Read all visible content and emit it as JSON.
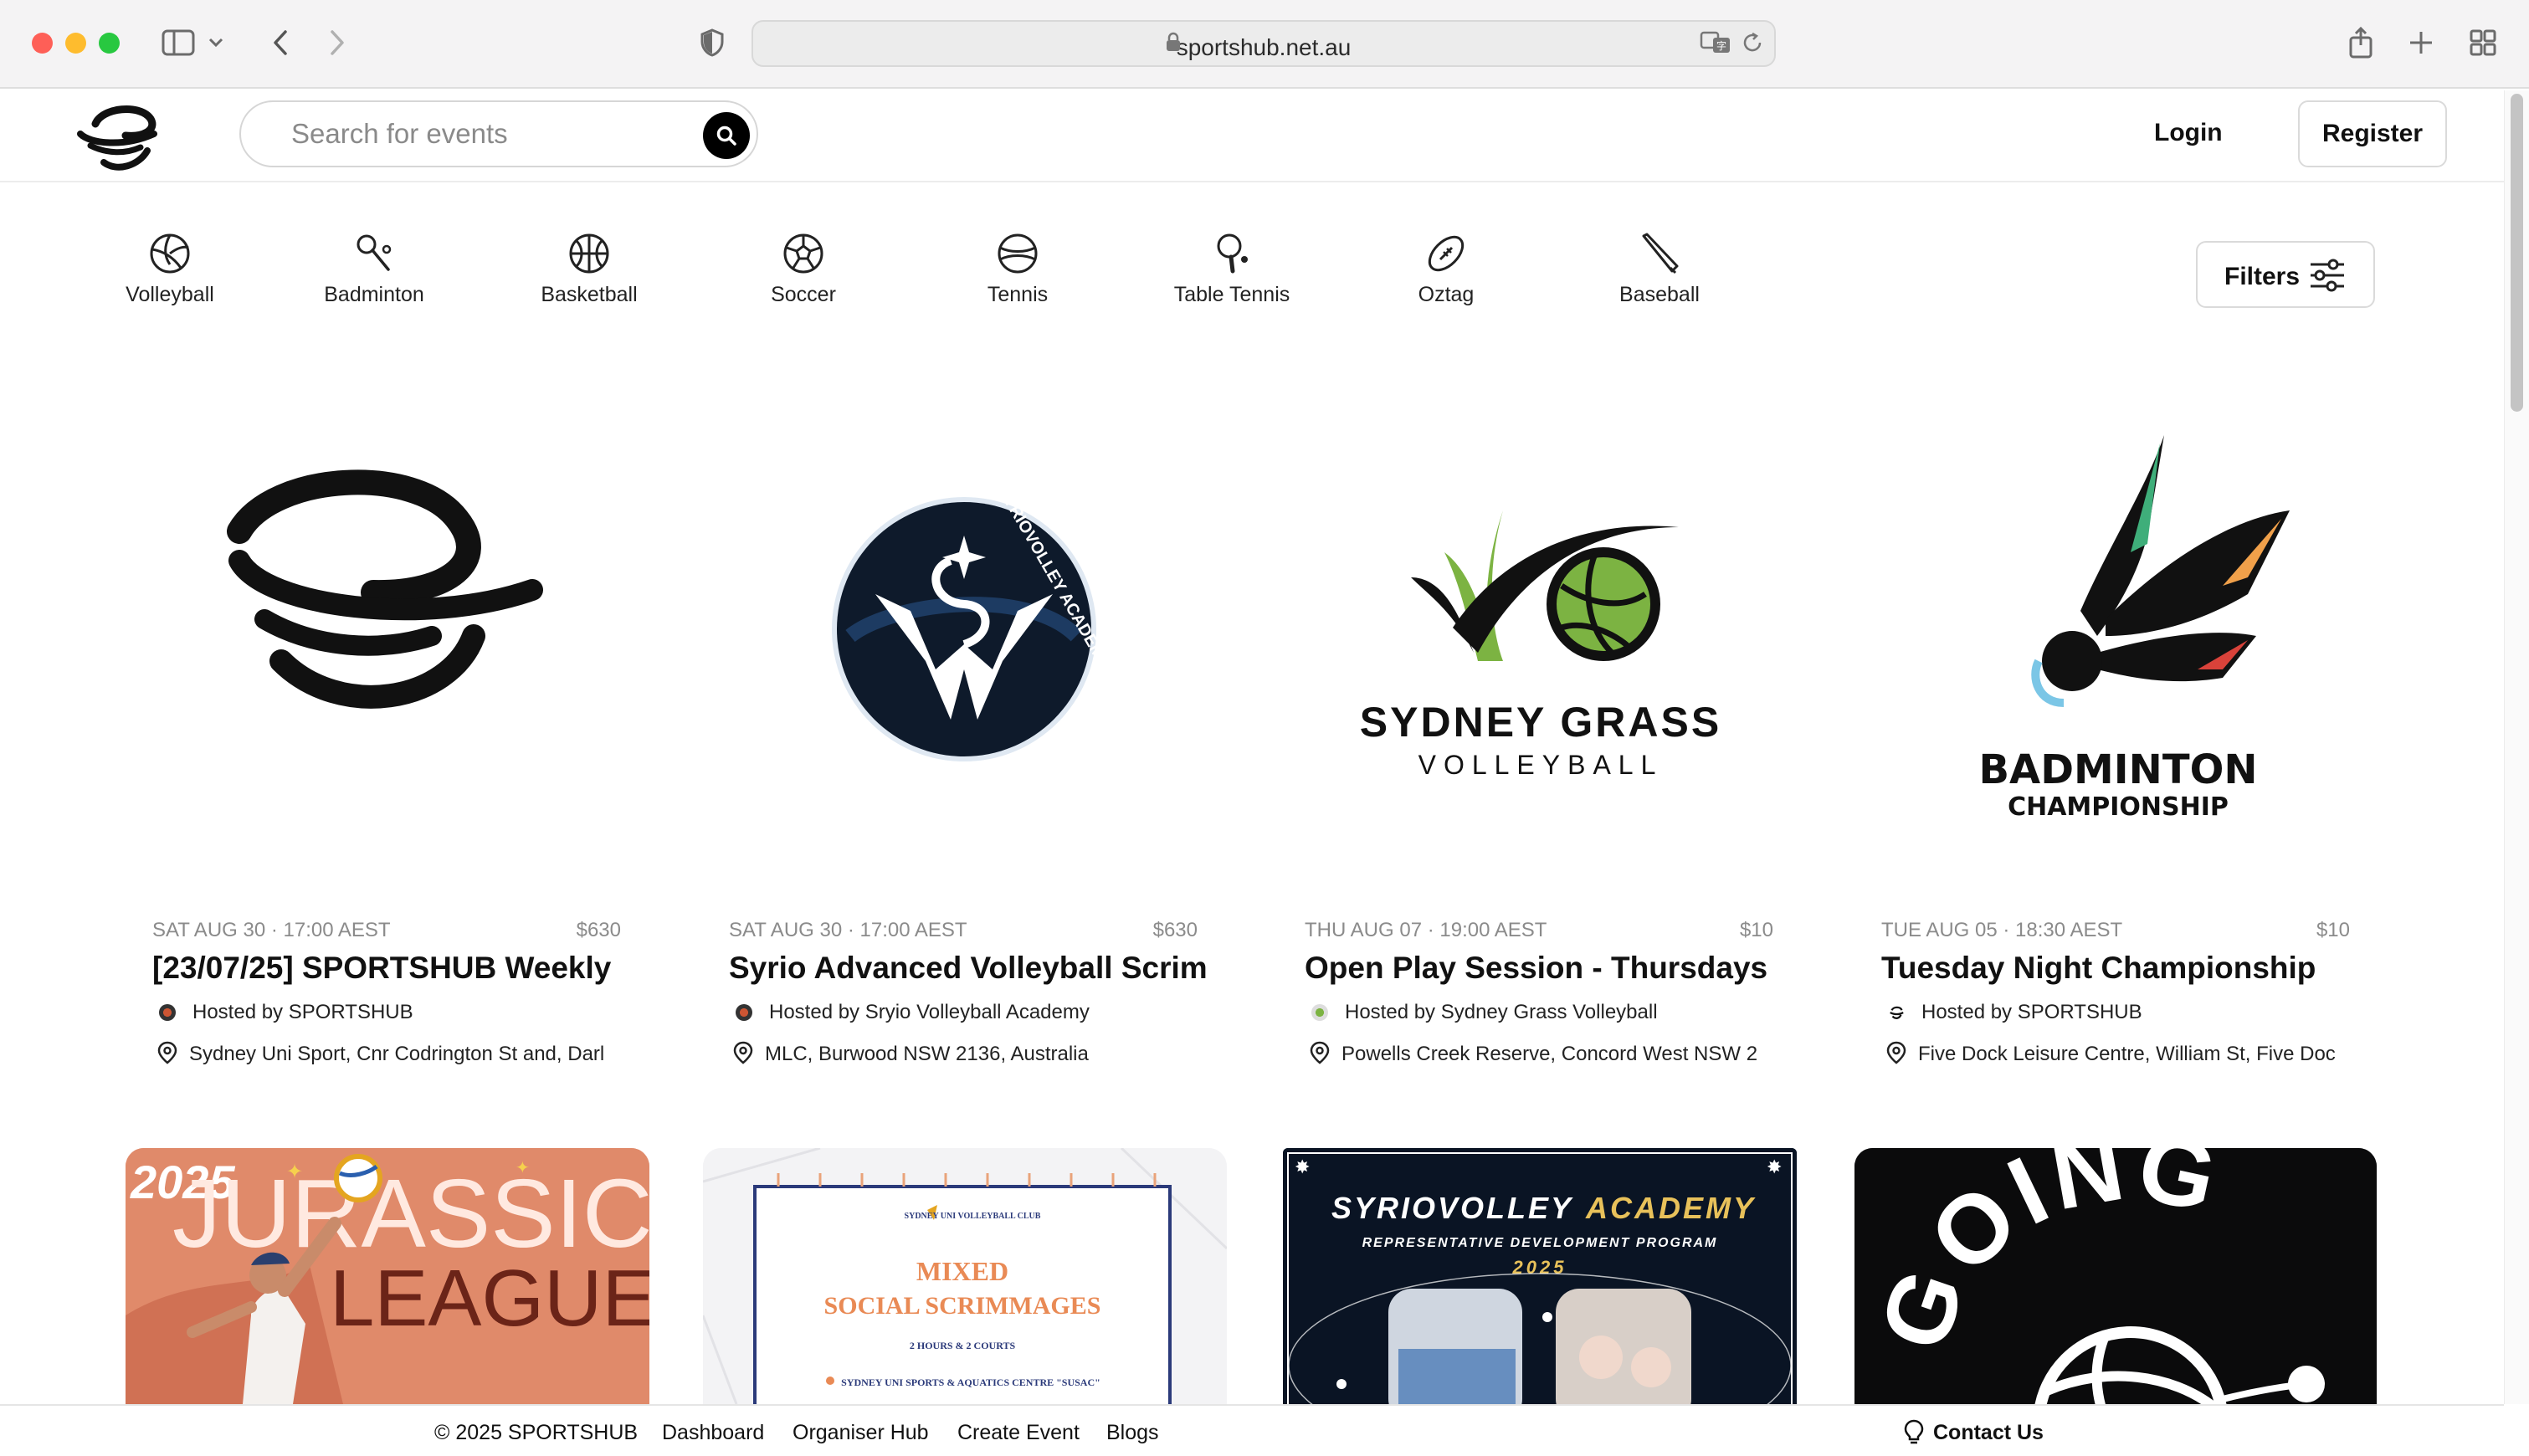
{
  "browser": {
    "url": "sportshub.net.au"
  },
  "header": {
    "search_placeholder": "Search for events",
    "login": "Login",
    "register": "Register"
  },
  "categories": [
    {
      "label": "Volleyball",
      "icon": "volleyball-icon"
    },
    {
      "label": "Badminton",
      "icon": "badminton-icon"
    },
    {
      "label": "Basketball",
      "icon": "basketball-icon"
    },
    {
      "label": "Soccer",
      "icon": "soccer-icon"
    },
    {
      "label": "Tennis",
      "icon": "tennis-icon"
    },
    {
      "label": "Table Tennis",
      "icon": "table-tennis-icon"
    },
    {
      "label": "Oztag",
      "icon": "oztag-icon"
    },
    {
      "label": "Baseball",
      "icon": "baseball-icon"
    }
  ],
  "filters_label": "Filters",
  "events": [
    {
      "datetime": "SAT AUG 30 · 17:00 AEST",
      "price": "$630",
      "title": "[23/07/25] SPORTSHUB Weekly",
      "host": "Hosted by SPORTSHUB",
      "location": "Sydney Uni Sport, Cnr Codrington St and, Darl"
    },
    {
      "datetime": "SAT AUG 30 · 17:00 AEST",
      "price": "$630",
      "title": "Syrio Advanced Volleyball Scrim",
      "host": "Hosted by Sryio Volleyball Academy",
      "location": "MLC, Burwood NSW 2136, Australia",
      "logo_text": "SYRIOVOLLEY ACADEMY"
    },
    {
      "datetime": "THU AUG 07 · 19:00 AEST",
      "price": "$10",
      "title": "Open Play Session - Thursdays",
      "host": "Hosted by Sydney Grass Volleyball",
      "location": "Powells Creek Reserve, Concord West NSW 2",
      "logo_line1": "SYDNEY GRASS",
      "logo_line2": "VOLLEYBALL"
    },
    {
      "datetime": "TUE AUG 05 · 18:30 AEST",
      "price": "$10",
      "title": "Tuesday Night Championship",
      "host": "Hosted by SPORTSHUB",
      "location": "Five Dock Leisure Centre, William St, Five Doc",
      "logo_line1": "BADMINTON",
      "logo_line2": "CHAMPIONSHIP"
    }
  ],
  "posters": {
    "jurassic": {
      "year": "2025",
      "line1": "JURASSIC",
      "line2": "LEAGUE"
    },
    "scrimmage": {
      "club": "SYDNEY UNI VOLLEYBALL CLUB",
      "line1": "MIXED",
      "line2": "SOCIAL SCRIMMAGES",
      "line3": "2 HOURS & 2 COURTS",
      "line4": "SYDNEY UNI SPORTS & AQUATICS CENTRE \"SUSAC\""
    },
    "syrio": {
      "line1a": "SYRIOVOLLEY",
      "line1b": "ACADEMY",
      "line2": "REPRESENTATIVE DEVELOPMENT PROGRAM",
      "line3": "2025"
    },
    "going": {
      "text": "GOING"
    }
  },
  "footer": {
    "copyright": "© 2025 SPORTSHUB",
    "dashboard": "Dashboard",
    "organiser_hub": "Organiser Hub",
    "create_event": "Create Event",
    "blogs": "Blogs",
    "contact": "Contact Us"
  },
  "colors": {
    "accent": "#000000",
    "grass_green": "#7cb342",
    "syrio_navy": "#0e1a2b",
    "jurassic_bg": "#e08a6a"
  }
}
